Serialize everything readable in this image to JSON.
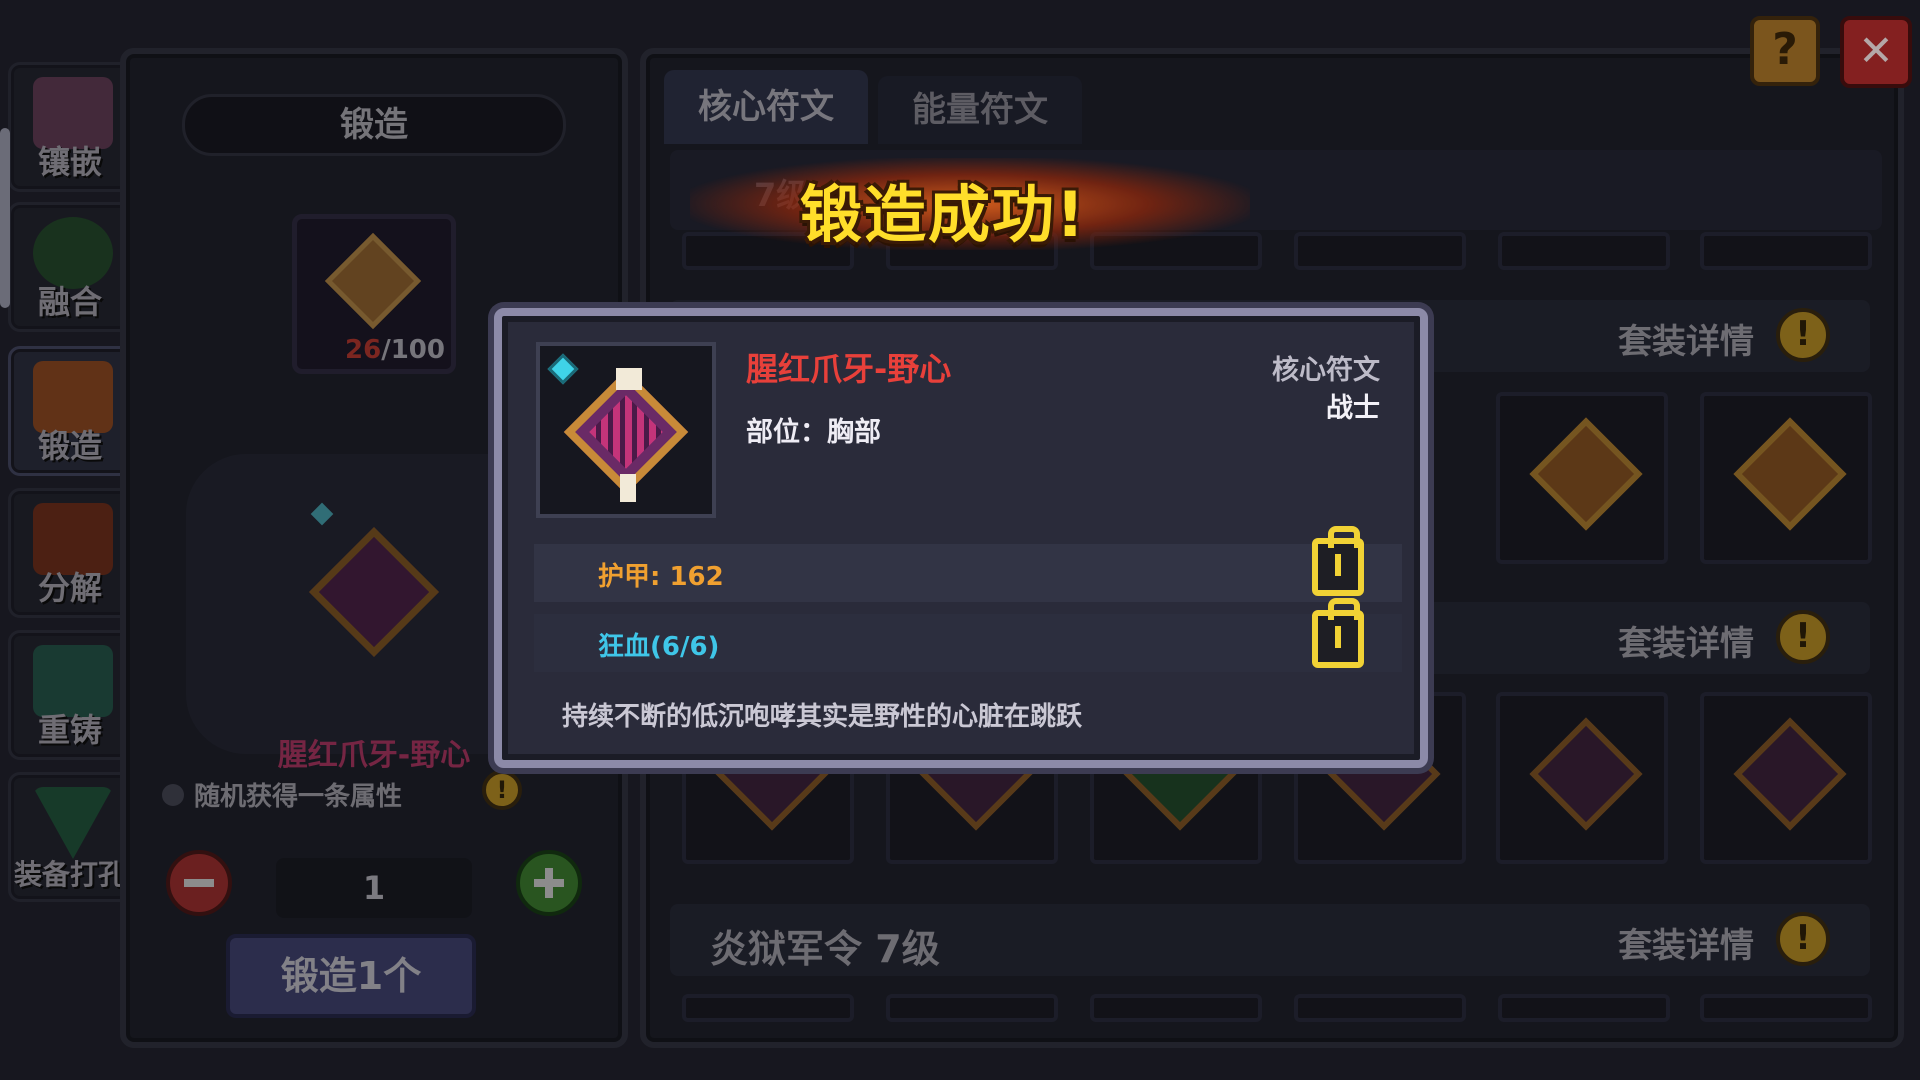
{
  "sidebar": {
    "items": [
      {
        "label": "镶嵌"
      },
      {
        "label": "融合"
      },
      {
        "label": "锻造",
        "active": true
      },
      {
        "label": "分解"
      },
      {
        "label": "重铸"
      },
      {
        "label": "装备打孔"
      }
    ]
  },
  "forge_panel": {
    "title": "锻造",
    "material_count": "26",
    "material_total": "/100",
    "item_name": "腥红爪牙-野心",
    "random_attr_text": "随机获得一条属性",
    "quantity": "1",
    "forge_button": "锻造1个"
  },
  "tabs": [
    {
      "label": "核心符文",
      "selected": true
    },
    {
      "label": "能量符文",
      "selected": false
    }
  ],
  "filter_partial": "7级",
  "banner": {
    "text": "锻造成功!"
  },
  "sets": [
    {
      "details_label": "套装详情"
    },
    {
      "details_label": "套装详情"
    },
    {
      "name": "炎狱军令",
      "level": "7级",
      "details_label": "套装详情"
    }
  ],
  "popup": {
    "item_name": "腥红爪牙-野心",
    "slot_label": "部位：胸部",
    "rune_type": "核心符文",
    "class": "战士",
    "stats": [
      {
        "text": "护甲: 162",
        "color": "#f0a030"
      },
      {
        "text": "狂血(6/6)",
        "color": "#3fc6e8"
      }
    ],
    "flavor": "持续不断的低沉咆哮其实是野性的心脏在跳跃"
  },
  "top_buttons": {
    "help": "?",
    "close": "✕"
  },
  "colors": {
    "item_name": "#e8403a",
    "gold": "#f1d235",
    "panel": "#262835"
  }
}
